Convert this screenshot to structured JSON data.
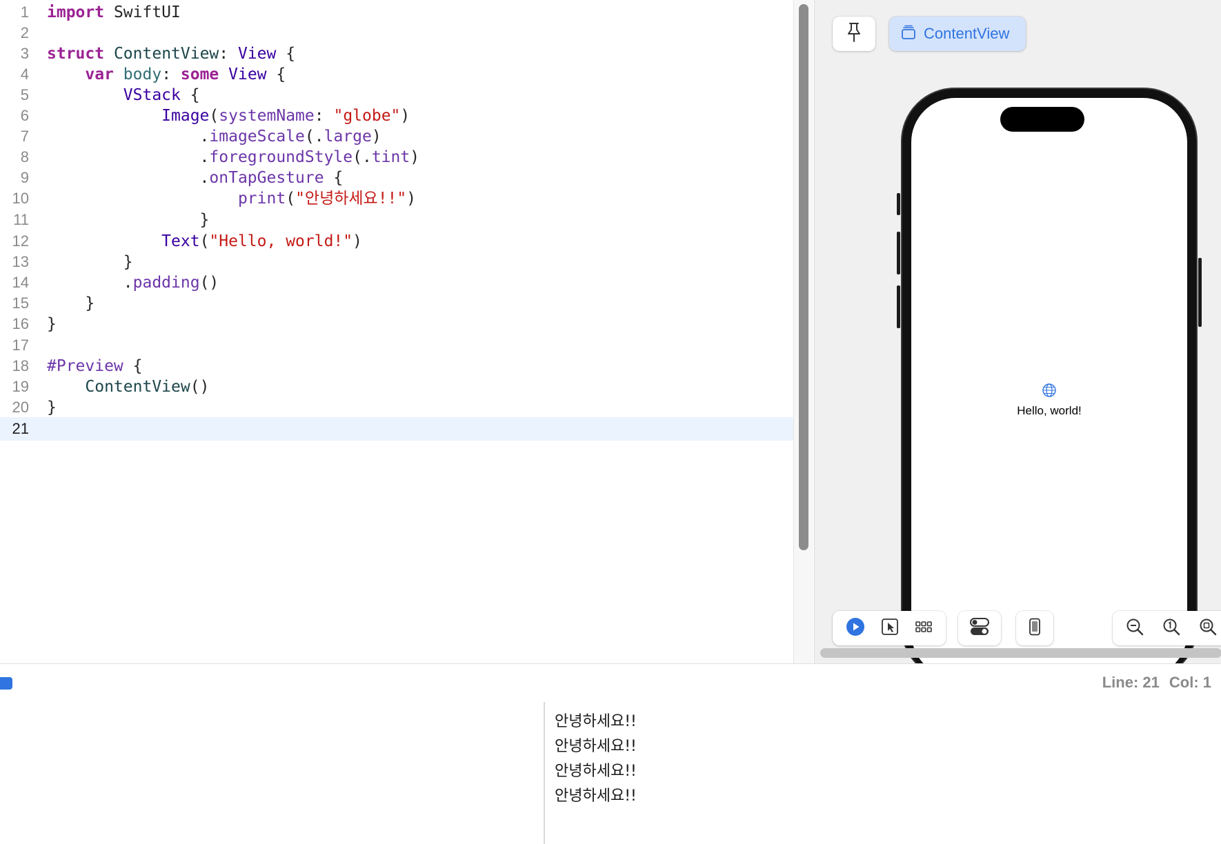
{
  "editor": {
    "current_line": 21,
    "lines": [
      {
        "n": "1"
      },
      {
        "n": "2"
      },
      {
        "n": "3"
      },
      {
        "n": "4"
      },
      {
        "n": "5"
      },
      {
        "n": "6"
      },
      {
        "n": "7"
      },
      {
        "n": "8"
      },
      {
        "n": "9"
      },
      {
        "n": "10"
      },
      {
        "n": "11"
      },
      {
        "n": "12"
      },
      {
        "n": "13"
      },
      {
        "n": "14"
      },
      {
        "n": "15"
      },
      {
        "n": "16"
      },
      {
        "n": "17"
      },
      {
        "n": "18"
      },
      {
        "n": "19"
      },
      {
        "n": "20"
      },
      {
        "n": "21"
      }
    ],
    "tokens": {
      "l1": [
        "import",
        " SwiftUI"
      ],
      "l3": [
        "struct",
        " ",
        "ContentView",
        ": ",
        "View",
        " {"
      ],
      "l4": [
        "    ",
        "var",
        " ",
        "body",
        ": ",
        "some",
        " ",
        "View",
        " {"
      ],
      "l5": [
        "        ",
        "VStack",
        " {"
      ],
      "l6": [
        "            ",
        "Image",
        "(",
        "systemName",
        ": ",
        "\"globe\"",
        ")"
      ],
      "l7": [
        "                .",
        "imageScale",
        "(.",
        "large",
        ")"
      ],
      "l8": [
        "                .",
        "foregroundStyle",
        "(.",
        "tint",
        ")"
      ],
      "l9": [
        "                .",
        "onTapGesture",
        " {"
      ],
      "l10": [
        "                    ",
        "print",
        "(",
        "\"안녕하세요!!\"",
        ")"
      ],
      "l11": [
        "                }"
      ],
      "l12": [
        "            ",
        "Text",
        "(",
        "\"Hello, world!\"",
        ")"
      ],
      "l13": [
        "        }"
      ],
      "l14": [
        "        .",
        "padding",
        "()"
      ],
      "l15": [
        "    }"
      ],
      "l16": [
        "}"
      ],
      "l18": [
        "#Preview",
        " {"
      ],
      "l19": [
        "    ",
        "ContentView",
        "()"
      ],
      "l20": [
        "}"
      ]
    }
  },
  "canvas": {
    "preview_tab_label": "ContentView",
    "preview_text": "Hello, world!",
    "accent_color": "#2f74e0"
  },
  "status": {
    "line": "Line: 21",
    "col": "Col: 1"
  },
  "console": {
    "lines": [
      "안녕하세요!!",
      "안녕하세요!!",
      "안녕하세요!!",
      "안녕하세요!!"
    ]
  }
}
